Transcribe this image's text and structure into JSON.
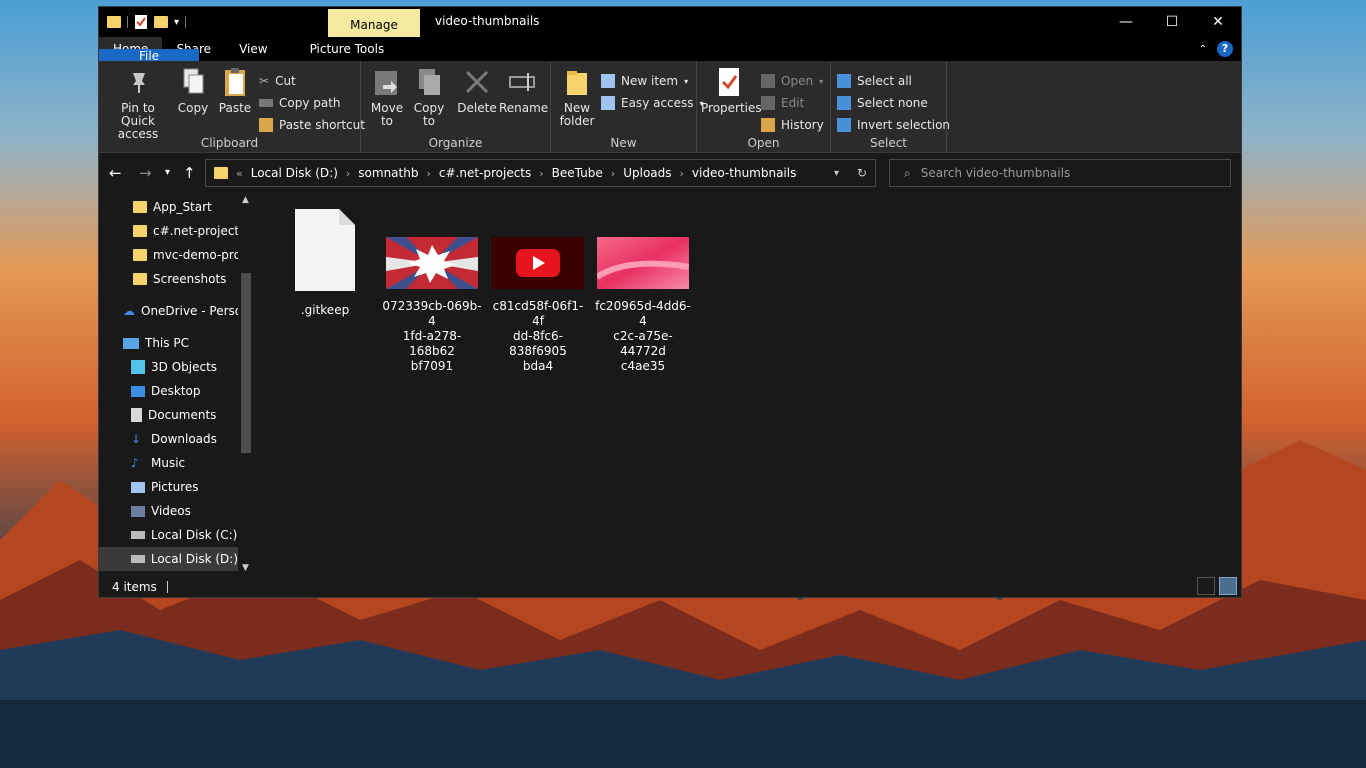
{
  "window": {
    "title": "video-thumbnails",
    "manage_tab": "Manage",
    "picture_tools": "Picture Tools",
    "controls": {
      "minimize": "—",
      "maximize": "☐",
      "close": "✕"
    }
  },
  "ribbon_tabs": [
    "File",
    "Home",
    "Share",
    "View"
  ],
  "ribbon": {
    "clipboard": {
      "label": "Clipboard",
      "pin": "Pin to Quick access",
      "copy": "Copy",
      "paste": "Paste",
      "cut": "Cut",
      "copy_path": "Copy path",
      "paste_shortcut": "Paste shortcut"
    },
    "organize": {
      "label": "Organize",
      "move_to": "Move to",
      "copy_to": "Copy to",
      "delete": "Delete",
      "rename": "Rename"
    },
    "new": {
      "label": "New",
      "new_folder": "New folder",
      "new_item": "New item",
      "easy_access": "Easy access"
    },
    "open": {
      "label": "Open",
      "properties": "Properties",
      "open": "Open",
      "edit": "Edit",
      "history": "History"
    },
    "select": {
      "label": "Select",
      "select_all": "Select all",
      "select_none": "Select none",
      "invert": "Invert selection"
    }
  },
  "address": {
    "breadcrumb": [
      "Local Disk (D:)",
      "somnathb",
      "c#.net-projects",
      "BeeTube",
      "Uploads",
      "video-thumbnails"
    ],
    "search_placeholder": "Search video-thumbnails"
  },
  "navpane": {
    "items": [
      {
        "label": "App_Start"
      },
      {
        "label": "c#.net-projects"
      },
      {
        "label": "mvc-demo-proj"
      },
      {
        "label": "Screenshots"
      },
      {
        "label": "OneDrive - Persor"
      },
      {
        "label": "This PC"
      },
      {
        "label": "3D Objects"
      },
      {
        "label": "Desktop"
      },
      {
        "label": "Documents"
      },
      {
        "label": "Downloads"
      },
      {
        "label": "Music"
      },
      {
        "label": "Pictures"
      },
      {
        "label": "Videos"
      },
      {
        "label": "Local Disk (C:)"
      },
      {
        "label": "Local Disk (D:)"
      }
    ]
  },
  "files": [
    {
      "name": ".gitkeep",
      "type": "blank-file-icon"
    },
    {
      "name_lines": [
        "072339cb-069b-4",
        "1fd-a278-168b62",
        "bf7091"
      ],
      "type": "burst-image"
    },
    {
      "name_lines": [
        "c81cd58f-06f1-4f",
        "dd-8fc6-838f6905",
        "bda4"
      ],
      "type": "youtube-image"
    },
    {
      "name_lines": [
        "fc20965d-4dd6-4",
        "c2c-a75e-44772d",
        "c4ae35"
      ],
      "type": "pink-image"
    }
  ],
  "status": {
    "count": "4 items"
  },
  "colors": {
    "file_tab": "#1a69c4",
    "manage_tab": "#f4eba0",
    "folder": "#f6d36b"
  }
}
